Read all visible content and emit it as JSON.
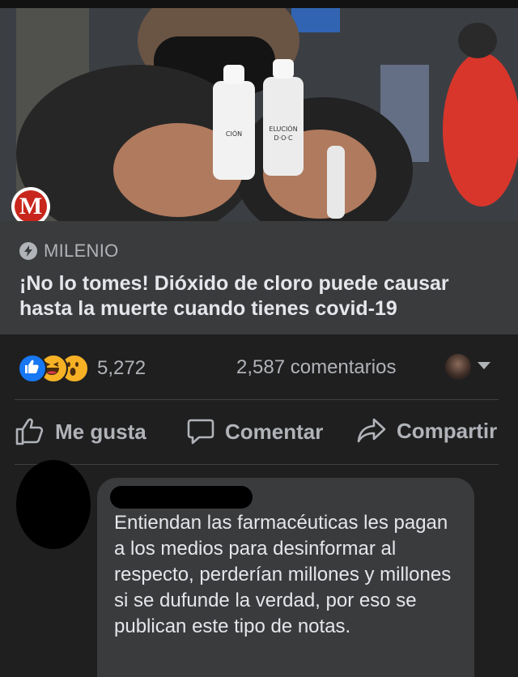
{
  "post": {
    "link_card": {
      "source": "MILENIO",
      "headline": "¡No lo tomes! Dióxido de cloro puede causar hasta la muerte cuando tienes covid-19",
      "logo_letter": "M"
    },
    "bottle_labels": [
      "CIÓN",
      "ELUCIÓN",
      "D·O·C"
    ],
    "reactions": {
      "icons": [
        "like-icon",
        "haha-icon",
        "wow-icon"
      ],
      "count": "5,272"
    },
    "comments_count": "2,587 comentarios",
    "actions": {
      "like": "Me gusta",
      "comment": "Comentar",
      "share": "Compartir"
    }
  },
  "comment": {
    "text": "Entiendan las farmacéuticas les pagan a los medios para desinformar al respecto, perderían millones y millones si se dufunde la verdad, por eso se publican este tipo de notas."
  },
  "colors": {
    "background": "#1f1f20",
    "card": "#3a3b3c",
    "secondary_text": "#b0b3b8",
    "like_blue": "#1877f2",
    "milenio_red": "#c8261c"
  }
}
